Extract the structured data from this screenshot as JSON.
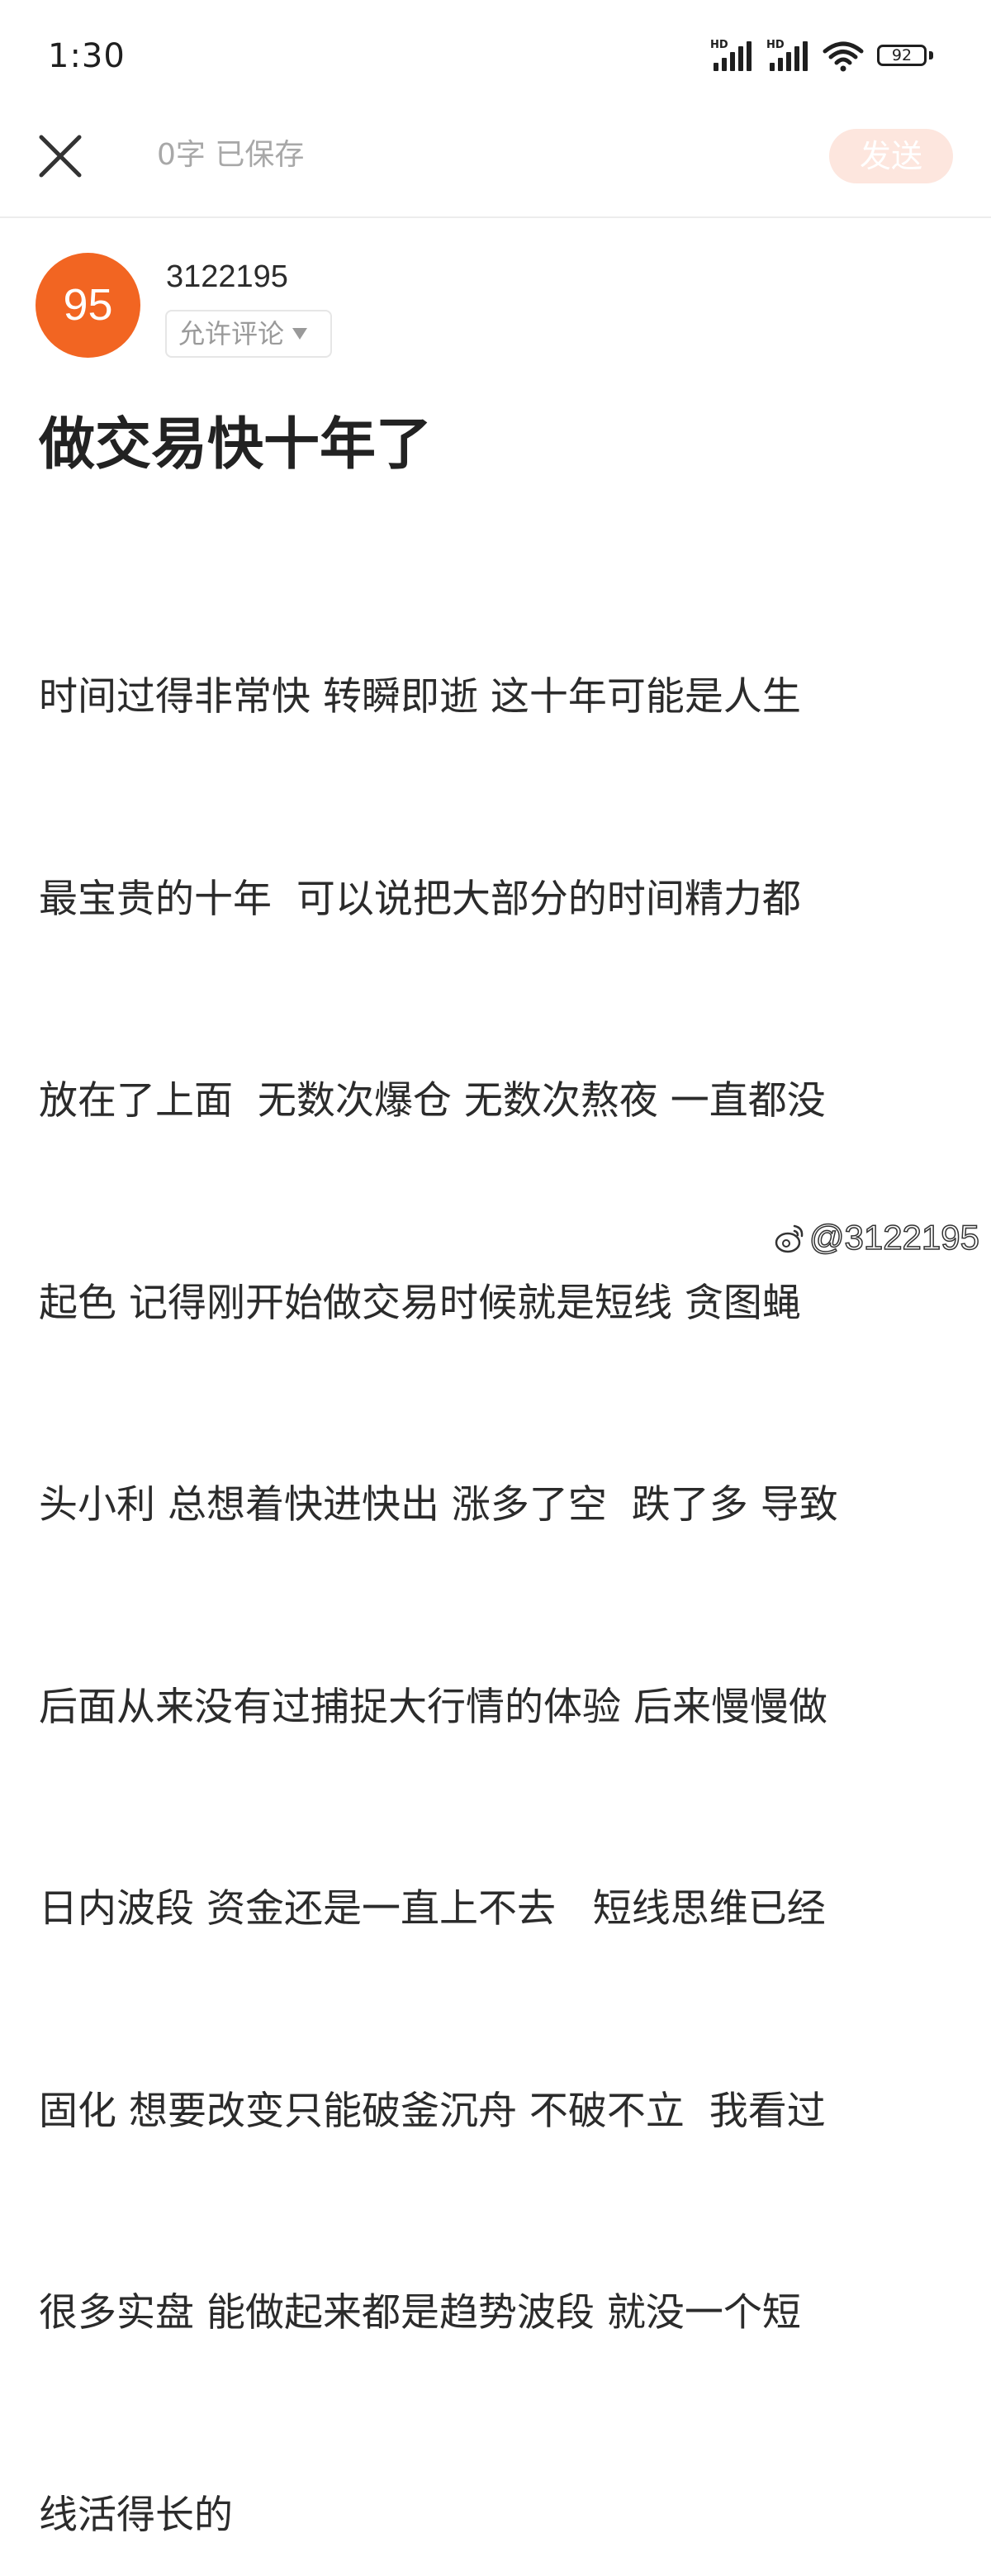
{
  "status_bar": {
    "time": "1:30",
    "signal_1_label": "HD",
    "signal_2_label": "HD",
    "battery_level": "92",
    "icons": [
      "signal-hd-icon",
      "signal-hd-icon",
      "wifi-icon",
      "battery-icon"
    ]
  },
  "toolbar": {
    "close_icon": "close-icon",
    "status_text": "0字 已保存",
    "send_label": "发送",
    "send_bg_color": "#fde6de"
  },
  "author": {
    "avatar_text": "95",
    "avatar_color": "#f26522",
    "username": "3122195",
    "comment_setting": "允许评论",
    "comment_setting_icon": "triangle-down-icon"
  },
  "post": {
    "title": "做交易快十年了",
    "body_lines": [
      "时间过得非常快 转瞬即逝 这十年可能是人生",
      "最宝贵的十年  可以说把大部分的时间精力都",
      "放在了上面  无数次爆仓 无数次熬夜 一直都没",
      "起色 记得刚开始做交易时候就是短线 贪图蝇",
      "头小利 总想着快进快出 涨多了空  跌了多 导致",
      "后面从来没有过捕捉大行情的体验 后来慢慢做",
      "日内波段 资金还是一直上不去   短线思维已经",
      "固化 想要改变只能破釜沉舟 不破不立  我看过",
      "很多实盘 能做起来都是趋势波段 就没一个短",
      "线活得长的"
    ]
  },
  "watermark": {
    "icon": "weibo-logo-icon",
    "text": "@3122195"
  }
}
